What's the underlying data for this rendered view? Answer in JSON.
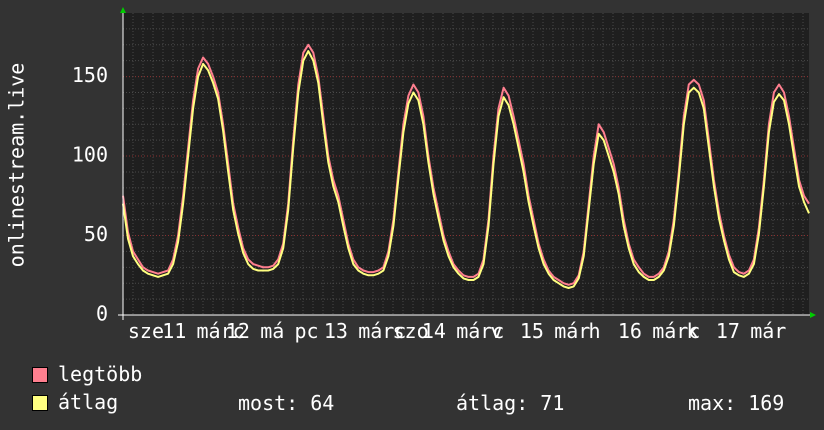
{
  "chart_data": {
    "type": "line",
    "ylabel": "onlinestream.live",
    "ylim": [
      0,
      190
    ],
    "yticks": [
      0,
      50,
      100,
      150
    ],
    "grid": true,
    "x_tick_labels": [
      "sze",
      "11",
      "márc",
      "12",
      "má",
      "pc",
      "13",
      "márc",
      "szo",
      "14",
      "márc",
      "v",
      "15",
      "már",
      "h",
      "16",
      "márc",
      "k",
      "17",
      "már"
    ],
    "colors": {
      "background": "#333333",
      "plot": "#1f1f1f",
      "major_grid": "#8a2f2f",
      "minor_grid": "#4a4a4a",
      "max_line": "#ff7f8f",
      "avg_line": "#ffff80",
      "axis": "#ffffff"
    },
    "series": [
      {
        "name": "legtöbb",
        "color": "#ff7f8f",
        "values": [
          75,
          52,
          40,
          35,
          30,
          28,
          27,
          26,
          27,
          28,
          35,
          50,
          75,
          105,
          135,
          155,
          162,
          158,
          150,
          140,
          120,
          95,
          70,
          55,
          42,
          35,
          32,
          31,
          30,
          30,
          31,
          35,
          45,
          70,
          110,
          145,
          165,
          170,
          165,
          150,
          125,
          100,
          85,
          75,
          60,
          45,
          35,
          30,
          28,
          27,
          27,
          28,
          30,
          40,
          60,
          90,
          120,
          138,
          145,
          140,
          125,
          100,
          80,
          65,
          50,
          40,
          32,
          28,
          25,
          24,
          24,
          26,
          35,
          60,
          100,
          130,
          143,
          138,
          125,
          110,
          95,
          75,
          60,
          45,
          35,
          28,
          24,
          22,
          20,
          19,
          20,
          25,
          40,
          70,
          100,
          120,
          115,
          105,
          95,
          80,
          60,
          45,
          35,
          30,
          26,
          24,
          24,
          26,
          30,
          40,
          60,
          90,
          125,
          145,
          148,
          145,
          135,
          110,
          85,
          65,
          50,
          38,
          30,
          27,
          26,
          28,
          35,
          55,
          85,
          120,
          140,
          145,
          140,
          125,
          105,
          85,
          75,
          70
        ]
      },
      {
        "name": "átlag",
        "color": "#ffff80",
        "values": [
          70,
          48,
          37,
          32,
          28,
          26,
          25,
          24,
          25,
          26,
          32,
          46,
          70,
          100,
          130,
          150,
          158,
          154,
          146,
          136,
          116,
          90,
          66,
          51,
          39,
          32,
          29,
          28,
          28,
          28,
          29,
          32,
          42,
          66,
          105,
          140,
          160,
          166,
          160,
          146,
          120,
          96,
          81,
          71,
          56,
          42,
          32,
          28,
          26,
          25,
          25,
          26,
          28,
          37,
          56,
          86,
          115,
          133,
          140,
          135,
          120,
          96,
          76,
          61,
          47,
          37,
          30,
          26,
          23,
          22,
          22,
          24,
          32,
          56,
          95,
          125,
          137,
          132,
          120,
          105,
          90,
          71,
          56,
          42,
          32,
          26,
          22,
          20,
          18,
          17,
          18,
          23,
          37,
          66,
          95,
          114,
          110,
          100,
          90,
          76,
          56,
          42,
          32,
          27,
          24,
          22,
          22,
          24,
          28,
          37,
          56,
          86,
          120,
          140,
          143,
          140,
          130,
          105,
          81,
          61,
          47,
          35,
          27,
          25,
          24,
          26,
          32,
          51,
          81,
          115,
          134,
          139,
          135,
          120,
          100,
          81,
          71,
          64
        ]
      }
    ]
  },
  "legend": {
    "max_label": "legtöbb",
    "avg_label": "átlag"
  },
  "stats": {
    "now": "most: 64",
    "avg": "átlag: 71",
    "max": "max: 169"
  }
}
